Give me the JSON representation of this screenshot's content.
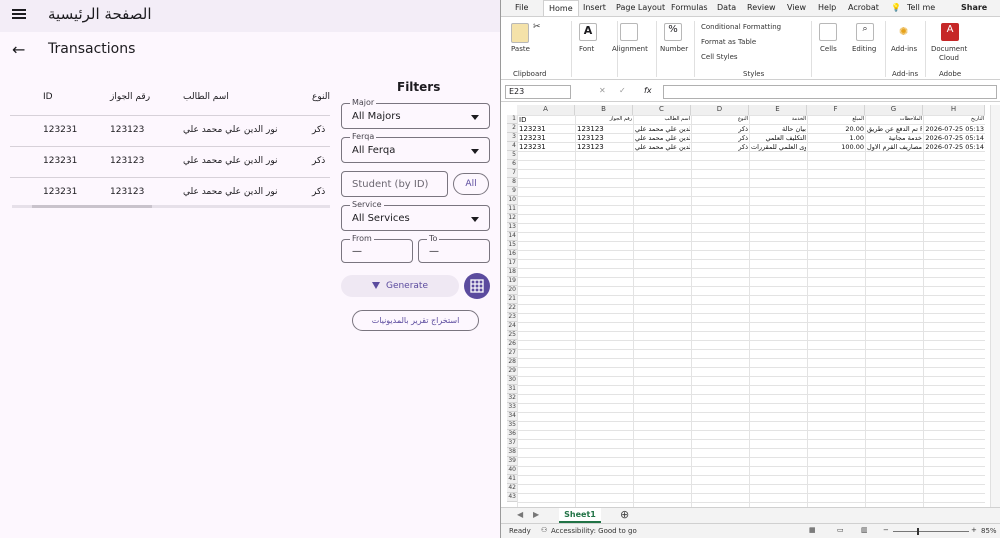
{
  "app": {
    "home_title": "الصفحة الرئيسية",
    "page_title": "Transactions"
  },
  "table": {
    "headers": [
      "ID",
      "رقم الجواز",
      "اسم الطالب",
      "النوع"
    ],
    "rows": [
      [
        "123231",
        "123123",
        "نور الدين علي محمد علي",
        "ذكر"
      ],
      [
        "123231",
        "123123",
        "نور الدين علي محمد علي",
        "ذكر"
      ],
      [
        "123231",
        "123123",
        "نور الدين علي محمد علي",
        "ذكر"
      ]
    ]
  },
  "filters": {
    "title": "Filters",
    "major_label": "Major",
    "major_value": "All Majors",
    "ferqa_label": "Ferqa",
    "ferqa_value": "All Ferqa",
    "student_placeholder": "Student (by ID)",
    "all_button": "All",
    "service_label": "Service",
    "service_value": "All Services",
    "from_label": "From",
    "from_value": "—",
    "to_label": "To",
    "to_value": "—",
    "generate_button": "Generate",
    "export_button": "استخراج تقرير بالمديونيات"
  },
  "excel": {
    "tabs": [
      "File",
      "Home",
      "Insert",
      "Page Layout",
      "Formulas",
      "Data",
      "Review",
      "View",
      "Help",
      "Acrobat",
      "Tell me",
      "Share"
    ],
    "ribbon": {
      "paste": "Paste",
      "clipboard": "Clipboard",
      "font": "Font",
      "alignment": "Alignment",
      "number": "Number",
      "conditional_formatting": "Conditional Formatting",
      "format_as_table": "Format as Table",
      "cell_styles": "Cell Styles",
      "styles": "Styles",
      "cells": "Cells",
      "editing": "Editing",
      "addins": "Add-ins",
      "addins_group": "Add-ins",
      "document_cloud_1": "Document",
      "document_cloud_2": "Cloud",
      "adobe": "Adobe"
    },
    "name_box": "E23",
    "fx": "fx",
    "columns": [
      "A",
      "B",
      "C",
      "D",
      "E",
      "F",
      "G",
      "H"
    ],
    "header_row": [
      "ID",
      "رقم الجواز",
      "اسم الطالب",
      "النوع",
      "الخدمة",
      "المبلغ",
      "الملاحظات",
      "التاريخ"
    ],
    "data_rows": [
      [
        "123231",
        "123123",
        "نور الدين علي محمد علي",
        "ذكر",
        "بيان حالة",
        "20.00",
        "تم الدفع عن طريق Pay",
        "2026-07-25 05:13"
      ],
      [
        "123231",
        "123123",
        "نور الدين علي محمد علي",
        "ذكر",
        "التكليف العلمي",
        "1.00",
        "خدمة مجانية",
        "2026-07-25 05:14"
      ],
      [
        "123231",
        "123123",
        "نور الدين علي محمد علي",
        "ذكر",
        "المحتوى العلمي للمقررات",
        "100.00",
        "مصاريف القرم الاول",
        "2026-07-25 05:14"
      ]
    ],
    "sheet_tab": "Sheet1",
    "status_ready": "Ready",
    "status_accessibility": "Accessibility: Good to go",
    "zoom": "85%"
  }
}
